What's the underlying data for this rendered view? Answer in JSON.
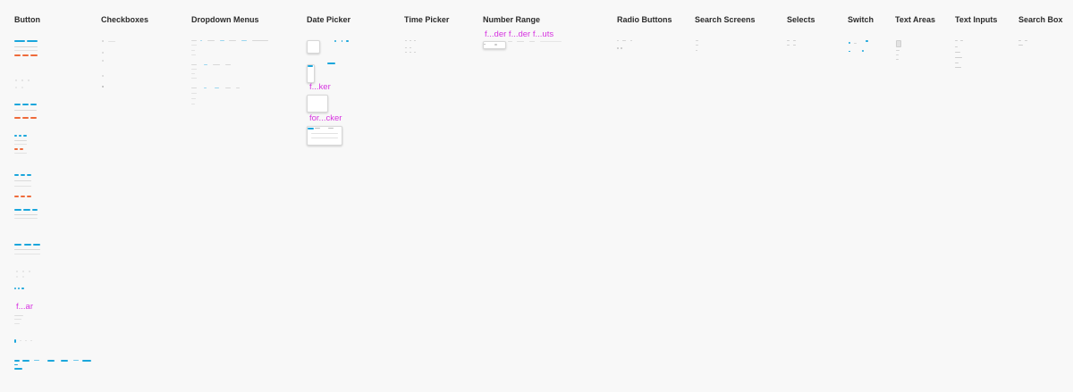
{
  "canvas": {
    "background": "#f8f8f8",
    "accent_color": "#1aa6dc",
    "warning_color": "#ee6a3a",
    "annotation_color": "#d633e0"
  },
  "columns": [
    {
      "key": "button",
      "title": "Button"
    },
    {
      "key": "checkboxes",
      "title": "Checkboxes"
    },
    {
      "key": "dropdown_menus",
      "title": "Dropdown Menus"
    },
    {
      "key": "date_picker",
      "title": "Date Picker"
    },
    {
      "key": "time_picker",
      "title": "Time Picker"
    },
    {
      "key": "number_range",
      "title": "Number Range"
    },
    {
      "key": "radio_buttons",
      "title": "Radio Buttons"
    },
    {
      "key": "search_screens",
      "title": "Search Screens"
    },
    {
      "key": "selects",
      "title": "Selects"
    },
    {
      "key": "switch",
      "title": "Switch"
    },
    {
      "key": "text_areas",
      "title": "Text Areas"
    },
    {
      "key": "text_inputs",
      "title": "Text Inputs"
    },
    {
      "key": "search_box",
      "title": "Search Box"
    }
  ],
  "labels": {
    "button_label": "f...ar",
    "date_picker_label_1": "f...ker",
    "date_picker_label_2": "for...cker",
    "number_range_label": "f...der f...der f...uts"
  }
}
